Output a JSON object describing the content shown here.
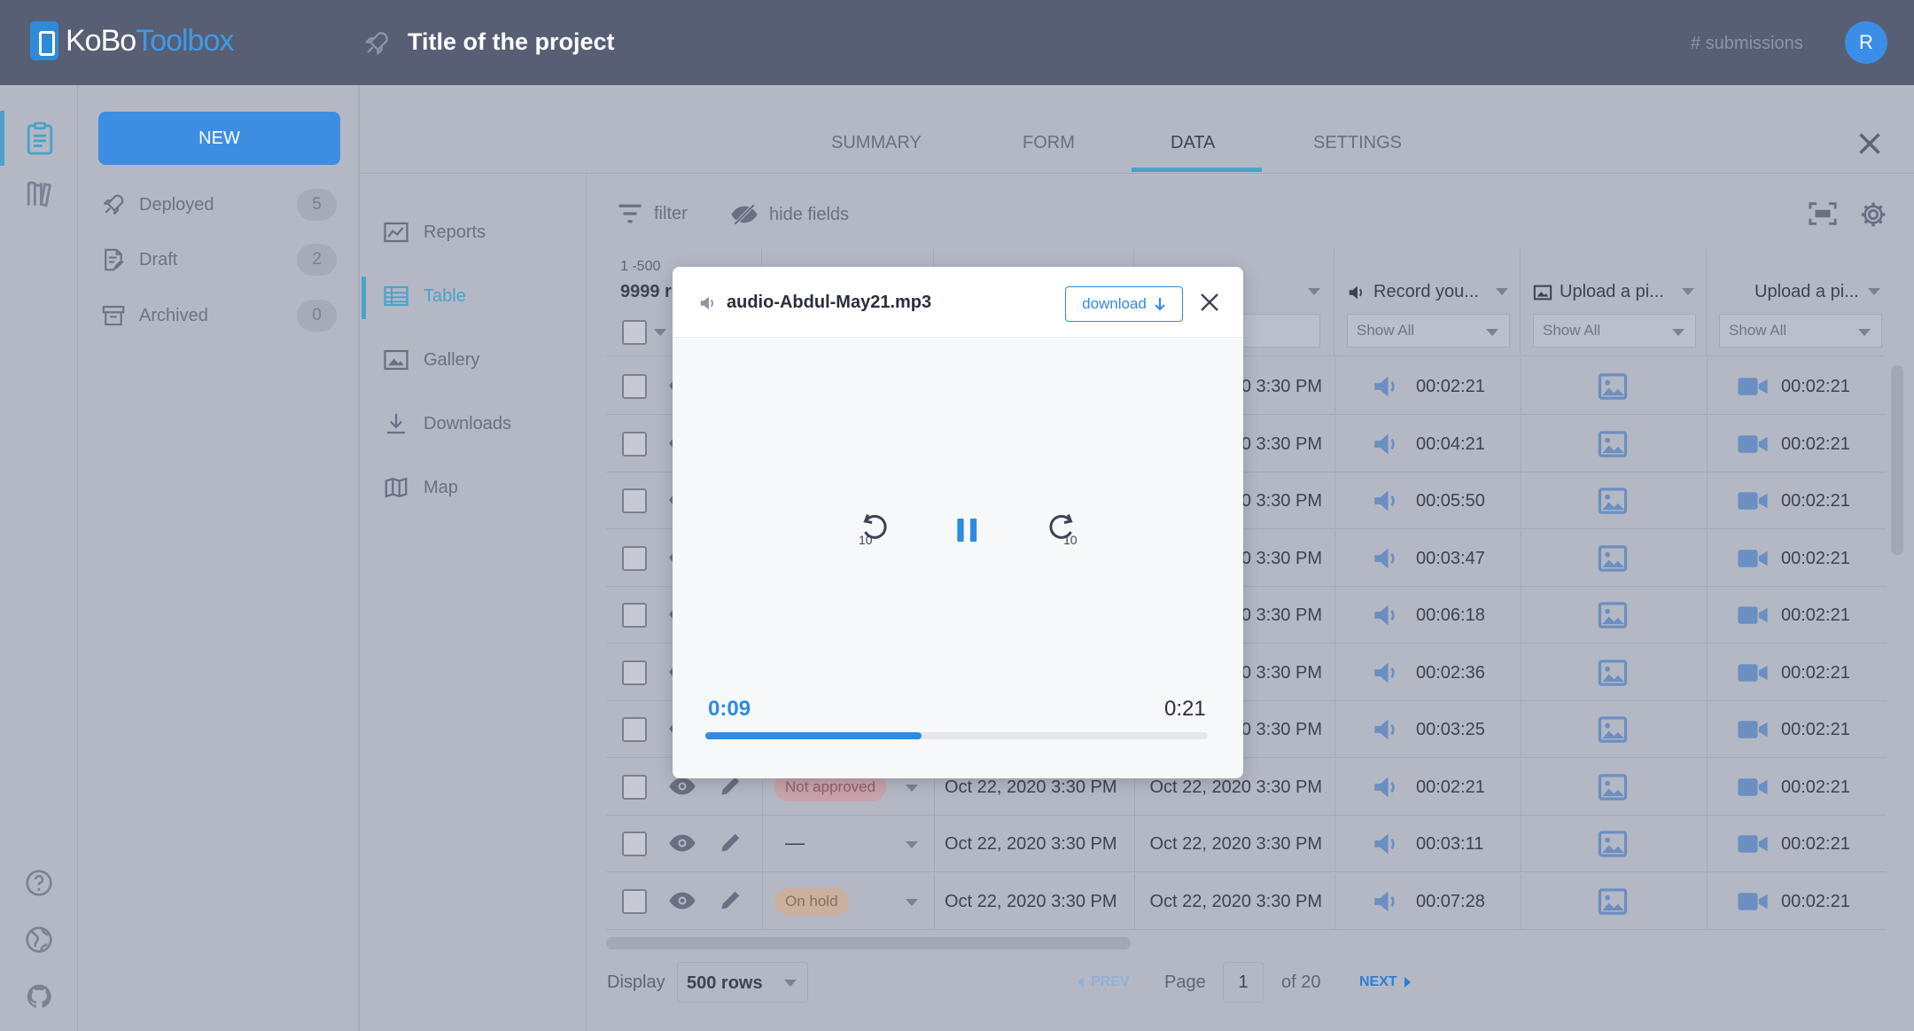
{
  "header": {
    "logo_a": "KoBo",
    "logo_b": "Toolbox",
    "project_title": "Title of the project",
    "submissions": "# submissions",
    "avatar_initial": "R"
  },
  "sidebar": {
    "new_label": "NEW",
    "items": [
      {
        "label": "Deployed",
        "count": "5"
      },
      {
        "label": "Draft",
        "count": "2"
      },
      {
        "label": "Archived",
        "count": "0"
      }
    ]
  },
  "tabs": [
    "SUMMARY",
    "FORM",
    "DATA",
    "SETTINGS"
  ],
  "active_tab": "DATA",
  "subnav": [
    "Reports",
    "Table",
    "Gallery",
    "Downloads",
    "Map"
  ],
  "toolbar": {
    "filter": "filter",
    "hide_fields": "hide fields"
  },
  "table": {
    "range_label": "1 -500",
    "count_label": "9999 r",
    "columns": [
      {
        "label": "Record you...",
        "filter": "Show All"
      },
      {
        "label": "Upload a pi...",
        "filter": "Show All"
      },
      {
        "label": "Upload a pi...",
        "filter": "Show All"
      }
    ],
    "rows": [
      {
        "status": "",
        "start": "",
        "end": "0 3:30 PM",
        "audio": "00:02:21",
        "video": "00:02:21"
      },
      {
        "status": "",
        "start": "",
        "end": "0 3:30 PM",
        "audio": "00:04:21",
        "video": "00:02:21"
      },
      {
        "status": "",
        "start": "",
        "end": "0 3:30 PM",
        "audio": "00:05:50",
        "video": "00:02:21"
      },
      {
        "status": "",
        "start": "",
        "end": "0 3:30 PM",
        "audio": "00:03:47",
        "video": "00:02:21"
      },
      {
        "status": "",
        "start": "",
        "end": "0 3:30 PM",
        "audio": "00:06:18",
        "video": "00:02:21"
      },
      {
        "status": "",
        "start": "",
        "end": "0 3:30 PM",
        "audio": "00:02:36",
        "video": "00:02:21"
      },
      {
        "status": "",
        "start": "",
        "end": "0 3:30 PM",
        "audio": "00:03:25",
        "video": "00:02:21"
      },
      {
        "status": "Not approved",
        "start": "Oct 22, 2020 3:30 PM",
        "end": "Oct 22, 2020 3:30 PM",
        "audio": "00:02:21",
        "video": "00:02:21"
      },
      {
        "status": "—",
        "start": "Oct 22, 2020 3:30 PM",
        "end": "Oct 22, 2020 3:30 PM",
        "audio": "00:03:11",
        "video": "00:02:21"
      },
      {
        "status": "On hold",
        "start": "Oct 22, 2020 3:30 PM",
        "end": "Oct 22, 2020 3:30 PM",
        "audio": "00:07:28",
        "video": "00:02:21"
      }
    ]
  },
  "footer": {
    "display_label": "Display",
    "rows_select": "500 rows",
    "prev": "PREV",
    "page_label": "Page",
    "page_value": "1",
    "of_label": "of 20",
    "next": "NEXT"
  },
  "modal": {
    "filename": "audio-Abdul-May21.mp3",
    "download_label": "download",
    "rewind_label": "10",
    "forward_label": "10",
    "current_time": "0:09",
    "total_time": "0:21",
    "progress_fraction": 0.43
  },
  "colors": {
    "accent": "#2d8ce2",
    "topbar": "#585e73",
    "overlay_bg": "#b4b8c5",
    "not_approved_badge": "#c9a3ab",
    "on_hold_badge": "#c9b09f"
  }
}
